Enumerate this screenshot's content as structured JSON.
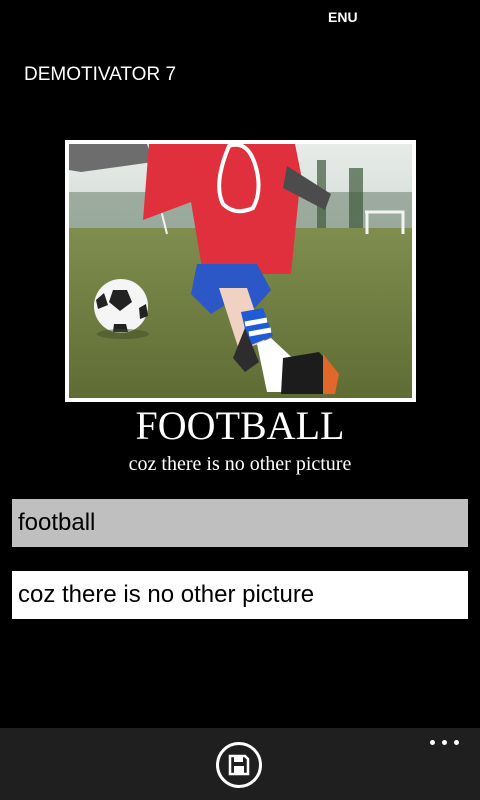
{
  "status_bar": {
    "language": "ENU"
  },
  "app": {
    "title": "DEMOTIVATOR 7"
  },
  "poster": {
    "image_icon": "football-photo",
    "heading": "FOOTBALL",
    "caption": "coz there is no other picture"
  },
  "form": {
    "title_value": "football",
    "caption_value": "coz there is no other picture"
  },
  "app_bar": {
    "save_icon": "save-icon",
    "more_icon": "more-icon",
    "background": "#1f1f1f"
  },
  "colors": {
    "background": "#000000",
    "title_field_bg": "#bfbfbf",
    "caption_field_bg": "#ffffff",
    "poster_border": "#ffffff"
  }
}
